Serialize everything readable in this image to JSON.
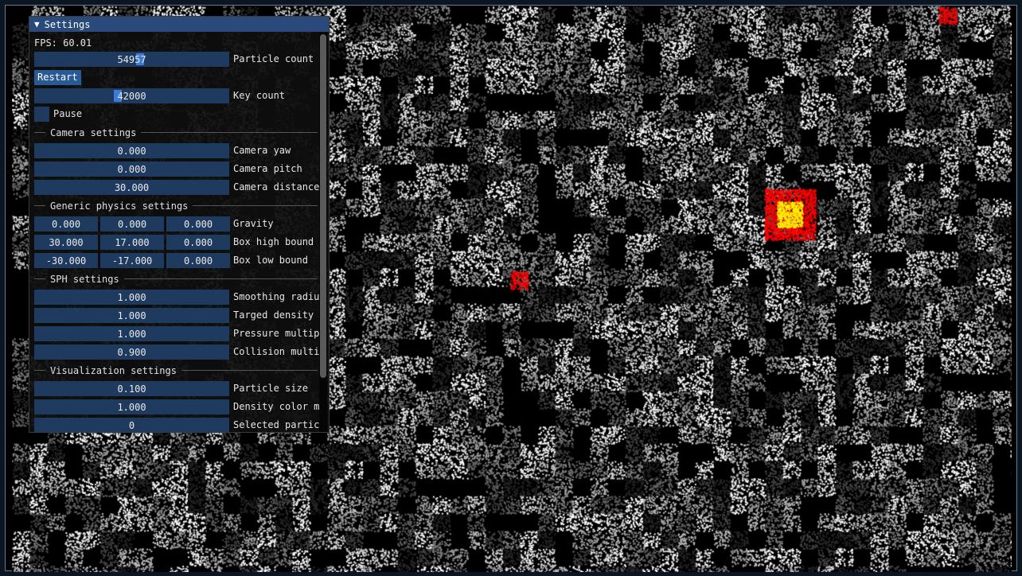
{
  "window": {
    "title": "Settings",
    "collapse_glyph": "▼"
  },
  "fps": "FPS: 60.01",
  "particle_count": {
    "value": "54957",
    "label": "Particle count"
  },
  "restart_label": "Restart",
  "key_count": {
    "value": "42000",
    "label": "Key count"
  },
  "pause_label": "Pause",
  "sections": {
    "camera": "Camera settings",
    "physics": "Generic physics settings",
    "sph": "SPH settings",
    "visualization": "Visualization settings"
  },
  "camera": {
    "yaw": {
      "value": "0.000",
      "label": "Camera yaw"
    },
    "pitch": {
      "value": "0.000",
      "label": "Camera pitch"
    },
    "distance": {
      "value": "30.000",
      "label": "Camera distance"
    }
  },
  "physics": {
    "gravity": {
      "values": [
        "0.000",
        "0.000",
        "0.000"
      ],
      "label": "Gravity"
    },
    "box_high": {
      "values": [
        "30.000",
        "17.000",
        "0.000"
      ],
      "label": "Box high bound"
    },
    "box_low": {
      "values": [
        "-30.000",
        "-17.000",
        "0.000"
      ],
      "label": "Box low bound"
    }
  },
  "sph": {
    "smoothing": {
      "value": "1.000",
      "label": "Smoothing radiu"
    },
    "target_density": {
      "value": "1.000",
      "label": "Targed density"
    },
    "pressure": {
      "value": "1.000",
      "label": "Pressure multip"
    },
    "collision": {
      "value": "0.900",
      "label": "Collision multi"
    }
  },
  "visualization": {
    "particle_size": {
      "value": "0.100",
      "label": "Particle size"
    },
    "density_color": {
      "value": "1.000",
      "label": "Density color m"
    },
    "selected": {
      "value": "0",
      "label": "Selected partic"
    }
  },
  "colors": {
    "accent": "#3d7bd6",
    "input_bg": "#1f3a5f",
    "titlebar": "#294a7a",
    "highlight_red": "#ff0000",
    "highlight_yellow": "#ffee00"
  }
}
